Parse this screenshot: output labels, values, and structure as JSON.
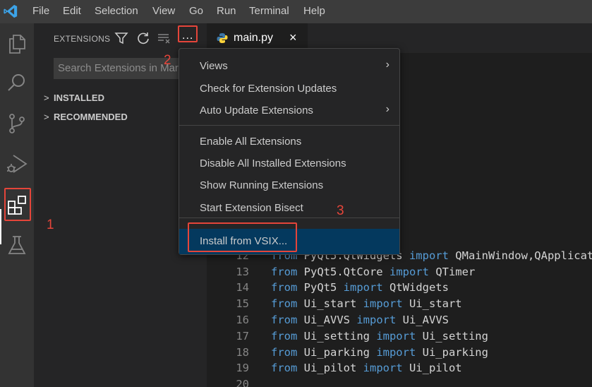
{
  "menubar": {
    "logo": "vscode-logo-icon",
    "items": [
      "File",
      "Edit",
      "Selection",
      "View",
      "Go",
      "Run",
      "Terminal",
      "Help"
    ]
  },
  "activitybar": {
    "icons": [
      "explorer-icon",
      "search-icon",
      "source-control-icon",
      "run-debug-icon",
      "extensions-icon",
      "testing-icon"
    ],
    "active": "extensions-icon"
  },
  "sidebar": {
    "title": "EXTENSIONS",
    "tools": [
      "filter-icon",
      "refresh-icon",
      "clear-icon",
      "more-actions-icon"
    ],
    "more_label": "...",
    "search_placeholder": "Search Extensions in Marketplace",
    "sections": [
      {
        "label": "INSTALLED",
        "chevron": ">"
      },
      {
        "label": "RECOMMENDED",
        "chevron": ">"
      }
    ]
  },
  "editor": {
    "tab": {
      "label": "main.py",
      "icon": "python-file-icon",
      "close": "×"
    },
    "lines": [
      {
        "n": "12",
        "parts": [
          [
            "from",
            "kw"
          ],
          [
            " PyQt5.QtWidgets ",
            ""
          ],
          [
            "import",
            "kw"
          ],
          [
            " QMainWindow,QApplicati",
            ""
          ]
        ]
      },
      {
        "n": "13",
        "parts": [
          [
            "from",
            "kw"
          ],
          [
            " PyQt5.QtCore ",
            ""
          ],
          [
            "import",
            "kw"
          ],
          [
            " QTimer",
            ""
          ]
        ]
      },
      {
        "n": "14",
        "parts": [
          [
            "from",
            "kw"
          ],
          [
            " PyQt5 ",
            ""
          ],
          [
            "import",
            "kw"
          ],
          [
            " QtWidgets",
            ""
          ]
        ]
      },
      {
        "n": "15",
        "parts": [
          [
            "from",
            "kw"
          ],
          [
            " Ui_start ",
            ""
          ],
          [
            "import",
            "kw"
          ],
          [
            " Ui_start",
            ""
          ]
        ]
      },
      {
        "n": "16",
        "parts": [
          [
            "from",
            "kw"
          ],
          [
            " Ui_AVVS ",
            ""
          ],
          [
            "import",
            "kw"
          ],
          [
            " Ui_AVVS",
            ""
          ]
        ]
      },
      {
        "n": "17",
        "parts": [
          [
            "from",
            "kw"
          ],
          [
            " Ui_setting ",
            ""
          ],
          [
            "import",
            "kw"
          ],
          [
            " Ui_setting",
            ""
          ]
        ]
      },
      {
        "n": "18",
        "parts": [
          [
            "from",
            "kw"
          ],
          [
            " Ui_parking ",
            ""
          ],
          [
            "import",
            "kw"
          ],
          [
            " Ui_parking",
            ""
          ]
        ]
      },
      {
        "n": "19",
        "parts": [
          [
            "from",
            "kw"
          ],
          [
            " Ui_pilot ",
            ""
          ],
          [
            "import",
            "kw"
          ],
          [
            " Ui_pilot",
            ""
          ]
        ]
      },
      {
        "n": "20",
        "parts": []
      }
    ]
  },
  "context_menu": {
    "groups": [
      [
        {
          "label": "Views",
          "submenu": true
        },
        {
          "label": "Check for Extension Updates",
          "submenu": false
        },
        {
          "label": "Auto Update Extensions",
          "submenu": true
        }
      ],
      [
        {
          "label": "Enable All Extensions",
          "submenu": false
        },
        {
          "label": "Disable All Installed Extensions",
          "submenu": false
        },
        {
          "label": "Show Running Extensions",
          "submenu": false
        },
        {
          "label": "Start Extension Bisect",
          "submenu": false
        }
      ],
      [
        {
          "label": "Install from VSIX...",
          "submenu": false,
          "highlighted": true
        }
      ]
    ]
  },
  "annotations": {
    "step1": "1",
    "step2": "2",
    "step3": "3",
    "color": "#e5453a"
  },
  "colors": {
    "keyword": "#569cd6",
    "highlight": "#04395e",
    "activitybar": "#333333",
    "sidebar": "#252526",
    "editor": "#1e1e1e"
  }
}
